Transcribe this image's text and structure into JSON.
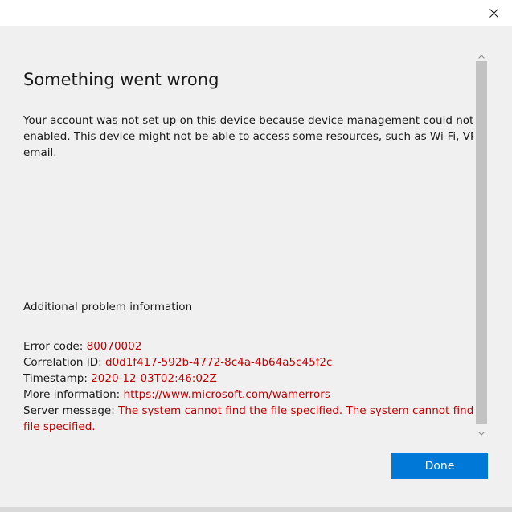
{
  "dialog": {
    "heading": "Something went wrong",
    "message": "Your account was not set up on this device because device management could not be enabled. This device might not be able to access some resources, such as Wi-Fi, VPN, or email.",
    "additional_heading": "Additional problem information",
    "details": {
      "error_code_label": "Error code:",
      "error_code_value": "80070002",
      "correlation_id_label": "Correlation ID:",
      "correlation_id_value": "d0d1f417-592b-4772-8c4a-4b64a5c45f2c",
      "timestamp_label": "Timestamp:",
      "timestamp_value": "2020-12-03T02:46:02Z",
      "more_info_label": "More information:",
      "more_info_value": "https://www.microsoft.com/wamerrors",
      "server_message_label": "Server message:",
      "server_message_value": "The system cannot find the file specified. The system cannot find the file specified."
    },
    "done_label": "Done"
  },
  "icons": {
    "close": "close-icon",
    "scroll_up": "chevron-up-icon",
    "scroll_down": "chevron-down-icon"
  },
  "colors": {
    "accent": "#0078d7",
    "error_text": "#c00000",
    "background": "#f0f0f0",
    "scroll_thumb": "#c2c2c2"
  }
}
